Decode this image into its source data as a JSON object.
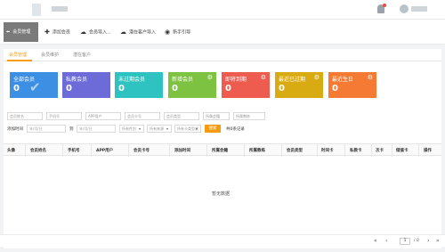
{
  "toolbar": {
    "active_label": "会员管理",
    "add_member": "添加会员",
    "import_member": "会员导入...",
    "import_potential": "潜在客户导入",
    "guide": "新手引导"
  },
  "tabs": [
    "会员管理",
    "会员维护",
    "潜在客户"
  ],
  "cards": [
    {
      "label": "全部会员",
      "value": "0",
      "color": "#3d8fe3"
    },
    {
      "label": "私教会员",
      "value": "0",
      "color": "#6c6bd8"
    },
    {
      "label": "未过期会员",
      "value": "0",
      "color": "#2ec3c0"
    },
    {
      "label": "新增会员",
      "value": "0",
      "color": "#7ec242"
    },
    {
      "label": "即将到期",
      "value": "0",
      "color": "#ee5b4f"
    },
    {
      "label": "最近已过期",
      "value": "0",
      "color": "#d9ab12"
    },
    {
      "label": "最近生日",
      "value": "0",
      "color": "#f57b34"
    }
  ],
  "filters": {
    "row1": [
      "会员姓名",
      "手机号",
      "APP用户",
      "会员卡号",
      "会员类型",
      "所属会籍",
      "所属教练"
    ],
    "add_time_label": "添加时间",
    "date_from": "年/月/日",
    "to_label": "到",
    "date_to": "年/月/日",
    "gender": "所有性别",
    "source": "所有来源",
    "card_status": "所有卡类型状",
    "search": "搜索",
    "count": "共0条记录"
  },
  "table": {
    "columns": [
      "头像",
      "会员姓名",
      "手机号",
      "APP用户",
      "会员卡号",
      "添加时间",
      "所属会籍",
      "所属教练",
      "会员类型",
      "时间卡",
      "私教卡",
      "次卡",
      "储值卡",
      "操作"
    ],
    "empty_text": "暂无数据"
  },
  "pager": {
    "first": "«",
    "prev": "‹",
    "page": "1",
    "total": "/ 0",
    "next": "›",
    "last": "»"
  }
}
